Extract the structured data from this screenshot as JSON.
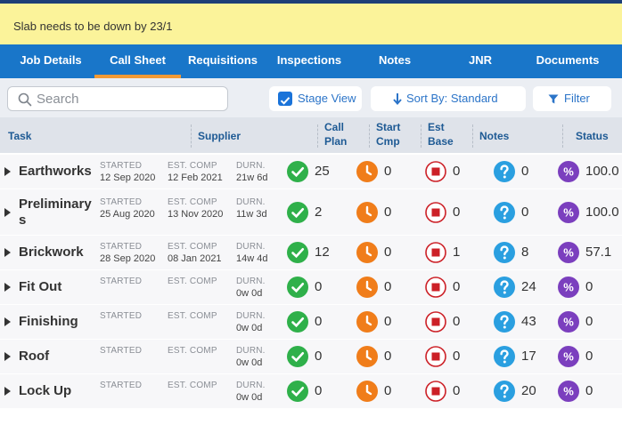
{
  "banner": {
    "text": "Slab needs to be down by 23/1"
  },
  "tabs": [
    {
      "label": "Job Details",
      "active": false
    },
    {
      "label": "Call Sheet",
      "active": true
    },
    {
      "label": "Requisitions",
      "active": false
    },
    {
      "label": "Inspections",
      "active": false
    },
    {
      "label": "Notes",
      "active": false
    },
    {
      "label": "JNR",
      "active": false
    },
    {
      "label": "Documents",
      "active": false
    }
  ],
  "toolbar": {
    "search_placeholder": "Search",
    "stage_view_label": "Stage View",
    "stage_view_checked": true,
    "sort_label": "Sort By: Standard",
    "filter_label": "Filter"
  },
  "columns": {
    "task": "Task",
    "supplier": "Supplier",
    "call_plan": [
      "Call",
      "Plan"
    ],
    "start_cmp": [
      "Start",
      "Cmp"
    ],
    "est_base": [
      "Est",
      "Base"
    ],
    "notes": "Notes",
    "status": "Status"
  },
  "labels": {
    "started": "STARTED",
    "est_comp": "EST. COMP",
    "durn": "DURN."
  },
  "colors": {
    "accent": "#1976c9",
    "tab_indicator": "#f39a34",
    "check": "#2fb04a",
    "clock": "#f07d1a",
    "stop": "#cc2027",
    "question": "#2a9fe0",
    "percent": "#7b3fbe"
  },
  "rows": [
    {
      "task": "Earthworks",
      "started": "12 Sep 2020",
      "est_comp": "12 Feb 2021",
      "durn": "21w 6d",
      "call_plan": "25",
      "start_cmp": "0",
      "est_base": "0",
      "notes": "0",
      "status": "100.0"
    },
    {
      "task": "Preliminary",
      "task2": "s",
      "started": "25 Aug 2020",
      "est_comp": "13 Nov 2020",
      "durn": "11w 3d",
      "call_plan": "2",
      "start_cmp": "0",
      "est_base": "0",
      "notes": "0",
      "status": "100.0"
    },
    {
      "task": "Brickwork",
      "started": "28 Sep 2020",
      "est_comp": "08 Jan 2021",
      "durn": "14w 4d",
      "call_plan": "12",
      "start_cmp": "0",
      "est_base": "1",
      "notes": "8",
      "status": "57.1"
    },
    {
      "task": "Fit Out",
      "started": "",
      "est_comp": "",
      "durn": "0w 0d",
      "call_plan": "0",
      "start_cmp": "0",
      "est_base": "0",
      "notes": "24",
      "status": "0"
    },
    {
      "task": "Finishing",
      "started": "",
      "est_comp": "",
      "durn": "0w 0d",
      "call_plan": "0",
      "start_cmp": "0",
      "est_base": "0",
      "notes": "43",
      "status": "0"
    },
    {
      "task": "Roof",
      "started": "",
      "est_comp": "",
      "durn": "0w 0d",
      "call_plan": "0",
      "start_cmp": "0",
      "est_base": "0",
      "notes": "17",
      "status": "0"
    },
    {
      "task": "Lock Up",
      "started": "",
      "est_comp": "",
      "durn": "0w 0d",
      "call_plan": "0",
      "start_cmp": "0",
      "est_base": "0",
      "notes": "20",
      "status": "0"
    }
  ]
}
